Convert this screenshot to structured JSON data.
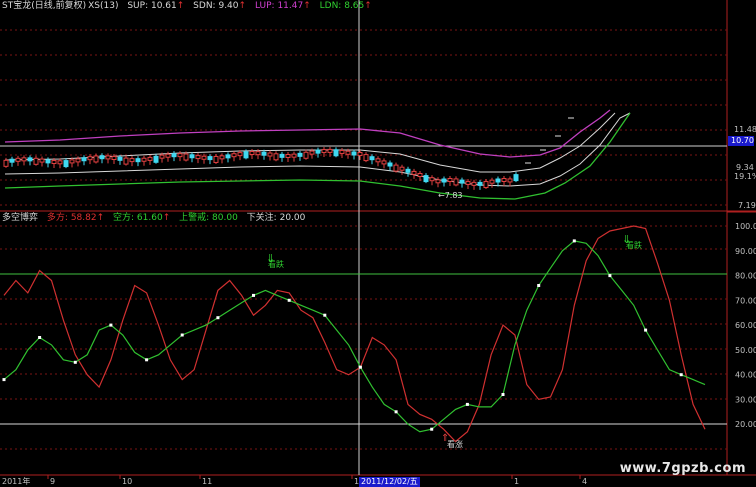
{
  "top_panel": {
    "title": "ST宝龙(日线,前复权)",
    "indicator": "XS(13)",
    "items": [
      {
        "label": "SUP:",
        "value": "10.61",
        "arrow": "↑",
        "color": "#d8d8d8"
      },
      {
        "label": "SDN:",
        "value": "9.40",
        "arrow": "↑",
        "color": "#d8d8d8"
      },
      {
        "label": "LUP:",
        "value": "11.47",
        "arrow": "↑",
        "color": "#d040d0"
      },
      {
        "label": "LDN:",
        "value": "8.65",
        "arrow": "↑",
        "color": "#30d030"
      }
    ],
    "axis_labels": [
      "11.48",
      "10.70",
      "9.34",
      "19.1%",
      "7.19"
    ],
    "low_annotation": "←7.83"
  },
  "bottom_panel": {
    "title": "多空博弈",
    "items": [
      {
        "label": "多方:",
        "value": "58.82",
        "arrow": "↑",
        "color": "#e03030"
      },
      {
        "label": "空方:",
        "value": "61.60",
        "arrow": "↑",
        "color": "#30d030"
      },
      {
        "label": "上警戒:",
        "value": "80.00",
        "color": "#30d030"
      },
      {
        "label": "下关注:",
        "value": "20.00",
        "color": "#d8d8d8"
      }
    ],
    "signals": [
      "看跌",
      "看跌",
      "看涨"
    ]
  },
  "x_axis": {
    "labels": [
      "2011年",
      "9",
      "10",
      "11",
      "1",
      "1",
      "4"
    ],
    "cursor_date": "2011/12/02/五"
  },
  "watermark": "www.7gpzb.com",
  "chart_data": [
    {
      "type": "line",
      "title": "多空博弈",
      "ylim": [
        10,
        100
      ],
      "ytick_labels": [
        "20.00",
        "30.00",
        "40.00",
        "50.00",
        "60.00",
        "70.00",
        "80.00",
        "90.00",
        "100.0"
      ],
      "ytick_values": [
        20,
        30,
        40,
        50,
        60,
        70,
        80,
        90,
        100
      ],
      "x": [
        0,
        1,
        2,
        3,
        4,
        5,
        6,
        7,
        8,
        9,
        10,
        11,
        12,
        13,
        14,
        15,
        16,
        17,
        18,
        19,
        20,
        21,
        22,
        23,
        24,
        25,
        26,
        27,
        28,
        29,
        30,
        31,
        32,
        33,
        34,
        35,
        36,
        37,
        38,
        39,
        40,
        41,
        42,
        43,
        44,
        45,
        46,
        47
      ],
      "series": [
        {
          "name": "多方",
          "color": "#d03030",
          "values": [
            72,
            78,
            73,
            82,
            78,
            62,
            48,
            40,
            35,
            46,
            62,
            76,
            73,
            60,
            46,
            38,
            42,
            58,
            74,
            78,
            72,
            64,
            68,
            74,
            73,
            66,
            63,
            53,
            42,
            40,
            43,
            55,
            52,
            46,
            28,
            24,
            22,
            18,
            13,
            17,
            28,
            48,
            60,
            56,
            36,
            30,
            31,
            42,
            68,
            86,
            95,
            98,
            99,
            100,
            99,
            85,
            70,
            48,
            28,
            18
          ]
        },
        {
          "name": "空方",
          "color": "#30c030",
          "values": [
            38,
            42,
            50,
            55,
            52,
            46,
            45,
            48,
            58,
            60,
            56,
            49,
            46,
            48,
            52,
            56,
            58,
            60,
            63,
            66,
            69,
            72,
            74,
            72,
            70,
            68,
            66,
            64,
            58,
            52,
            43,
            35,
            28,
            25,
            20,
            17,
            18,
            22,
            26,
            28,
            27,
            27,
            32,
            52,
            66,
            76,
            83,
            90,
            94,
            93,
            88,
            80,
            74,
            68,
            58,
            50,
            42,
            40,
            38,
            36
          ]
        }
      ],
      "reference_lines": [
        {
          "name": "上警戒",
          "value": 80
        },
        {
          "name": "下关注",
          "value": 20
        }
      ]
    }
  ]
}
